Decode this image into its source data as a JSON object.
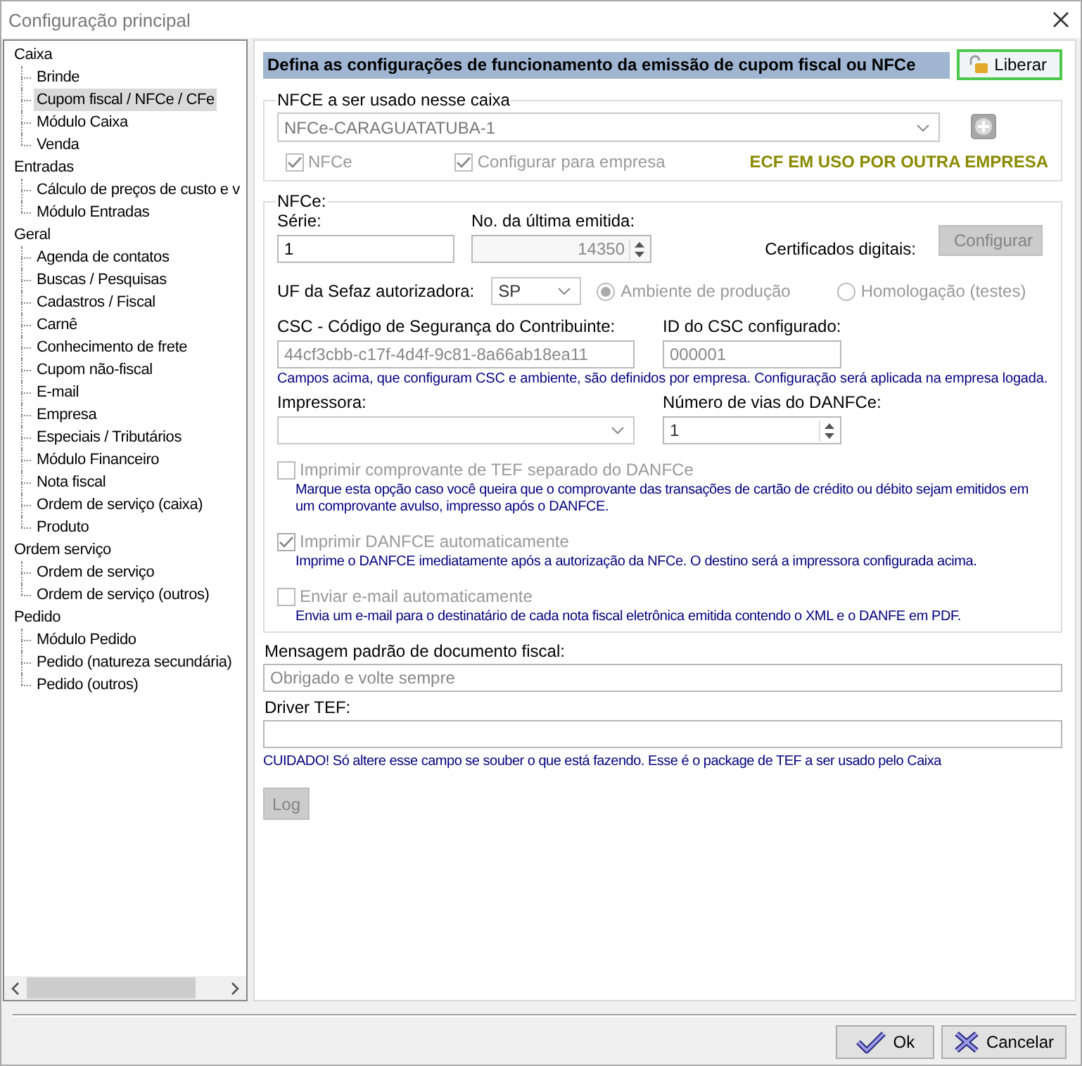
{
  "window": {
    "title": "Configuração principal"
  },
  "tree": [
    {
      "label": "Caixa",
      "selected": false,
      "children": [
        {
          "label": "Brinde",
          "selected": false
        },
        {
          "label": "Cupom fiscal / NFCe / CFe",
          "selected": true
        },
        {
          "label": "Módulo Caixa",
          "selected": false
        },
        {
          "label": "Venda",
          "selected": false
        }
      ]
    },
    {
      "label": "Entradas",
      "selected": false,
      "children": [
        {
          "label": "Cálculo de preços de custo e v",
          "selected": false
        },
        {
          "label": "Módulo Entradas",
          "selected": false
        }
      ]
    },
    {
      "label": "Geral",
      "selected": false,
      "children": [
        {
          "label": "Agenda de contatos",
          "selected": false
        },
        {
          "label": "Buscas / Pesquisas",
          "selected": false
        },
        {
          "label": "Cadastros / Fiscal",
          "selected": false
        },
        {
          "label": "Carnê",
          "selected": false
        },
        {
          "label": "Conhecimento de frete",
          "selected": false
        },
        {
          "label": "Cupom não-fiscal",
          "selected": false
        },
        {
          "label": "E-mail",
          "selected": false
        },
        {
          "label": "Empresa",
          "selected": false
        },
        {
          "label": "Especiais / Tributários",
          "selected": false
        },
        {
          "label": "Módulo Financeiro",
          "selected": false
        },
        {
          "label": "Nota fiscal",
          "selected": false
        },
        {
          "label": "Ordem de serviço (caixa)",
          "selected": false
        },
        {
          "label": "Produto",
          "selected": false
        }
      ]
    },
    {
      "label": "Ordem serviço",
      "selected": false,
      "children": [
        {
          "label": "Ordem de serviço",
          "selected": false
        },
        {
          "label": "Ordem de serviço (outros)",
          "selected": false
        }
      ]
    },
    {
      "label": "Pedido",
      "selected": false,
      "children": [
        {
          "label": "Módulo Pedido",
          "selected": false
        },
        {
          "label": "Pedido (natureza secundária)",
          "selected": false
        },
        {
          "label": "Pedido (outros)",
          "selected": false
        }
      ]
    }
  ],
  "header": {
    "text": "Defina as configurações de funcionamento da emissão de cupom fiscal ou NFCe",
    "button": "Liberar"
  },
  "nfce_group": {
    "title": "NFCE a ser usado nesse caixa",
    "combo": "NFCe-CARAGUATATUBA-1",
    "checks": [
      {
        "label": "NFCe",
        "checked": true,
        "disabled": true
      },
      {
        "label": "Configurar para empresa",
        "checked": true,
        "disabled": true
      }
    ],
    "status": "ECF EM USO POR OUTRA EMPRESA"
  },
  "nfce": {
    "title": "NFCe:",
    "serie": {
      "label": "Série:",
      "value": "1"
    },
    "ultima": {
      "label": "No. da última emitida:",
      "value": "14350"
    },
    "certificados": {
      "label": "Certificados digitais:",
      "button": "Configurar",
      "disabled": true
    },
    "uf": {
      "label": "UF da Sefaz autorizadora:",
      "value": "SP"
    },
    "ambiente": [
      {
        "label": "Ambiente de produção",
        "selected": true,
        "disabled": true
      },
      {
        "label": "Homologação (testes)",
        "selected": false,
        "disabled": true
      }
    ],
    "csc": {
      "label": "CSC - Código de Segurança do Contribuinte:",
      "value": "44cf3cbb-c17f-4d4f-9c81-8a66ab18ea11"
    },
    "csc_id": {
      "label": "ID do CSC configurado:",
      "value": "000001"
    },
    "csc_note": "Campos acima, que configuram CSC e ambiente, são definidos por empresa. Configuração será aplicada na empresa logada.",
    "impressora": {
      "label": "Impressora:"
    },
    "vias": {
      "label": "Número de vias do DANFCe:",
      "value": "1"
    },
    "options": [
      {
        "label": "Imprimir comprovante de TEF separado do DANFCe",
        "checked": false,
        "disabled": true,
        "note": "Marque esta opção caso você queira que o comprovante das transações de cartão de crédito ou débito sejam emitidos em um comprovante avulso, impresso após o DANFCE."
      },
      {
        "label": "Imprimir DANFCE automaticamente",
        "checked": true,
        "disabled": true,
        "note": "Imprime o DANFCE imediatamente após a autorização da NFCe. O destino será a impressora configurada acima."
      },
      {
        "label": "Enviar e-mail automaticamente",
        "checked": false,
        "disabled": true,
        "note": "Envia um e-mail para o destinatário de cada nota fiscal eletrônica emitida contendo o XML e o DANFE em PDF."
      }
    ]
  },
  "mensagem": {
    "label": "Mensagem padrão de documento fiscal:",
    "value": "Obrigado e volte sempre"
  },
  "driver_tef": {
    "label": "Driver TEF:"
  },
  "warning": "CUIDADO! Só altere esse campo se souber o que está fazendo. Esse é o package de TEF a ser usado pelo Caixa",
  "log_button": {
    "label": "Log",
    "disabled": true
  },
  "buttons": [
    {
      "label": "Ok",
      "kind": "ok"
    },
    {
      "label": "Cancelar",
      "kind": "cancel"
    }
  ]
}
